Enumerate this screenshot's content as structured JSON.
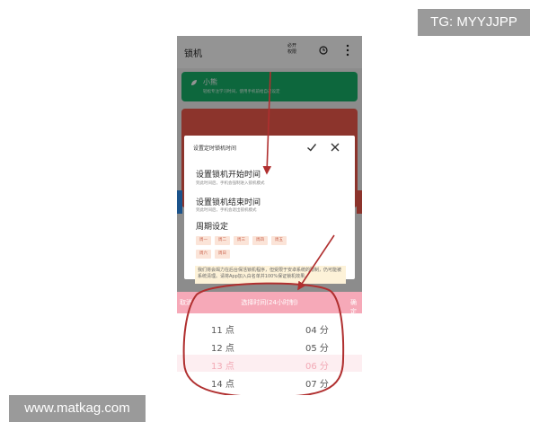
{
  "watermarks": {
    "telegram": "TG: MYYJJPP",
    "site": "www.matkag.com"
  },
  "app": {
    "title": "锁机",
    "permission_label": "必开权限",
    "icons": {
      "clock": "clock-icon",
      "more": "more-vertical-icon"
    }
  },
  "cards": [
    {
      "title": "小熊",
      "subtitle": "轻松专注学习时间，使用手机前给自己设定",
      "color": "#17b169",
      "icon": "leaf-icon"
    },
    {
      "color": "#f15b4c"
    }
  ],
  "dialog": {
    "title": "设置定时锁机时间",
    "icons": {
      "confirm": "check-icon",
      "close": "close-icon"
    },
    "options": [
      {
        "title": "设置锁机开始时间",
        "subtitle": "到此时间后，手机会强制进入锁机模式"
      },
      {
        "title": "设置锁机结束时间",
        "subtitle": "到此时间后，手机会退出锁机模式"
      }
    ],
    "cycle_title": "周期设定",
    "days": [
      "周一",
      "周二",
      "周三",
      "周四",
      "周五",
      "周六",
      "周日"
    ],
    "description": "我们将会竭力在后台保活锁机程序，但受限于安卓系统的限制，仍可能被系统清理。请将App加入白名单并100%保证锁机效果。"
  },
  "picker": {
    "title": "选择时间(24小时制)",
    "cancel_label": "取消",
    "ok_label": "确定",
    "rows": [
      {
        "hour": "11 点",
        "minute": "04 分",
        "selected": false
      },
      {
        "hour": "12 点",
        "minute": "05 分",
        "selected": false
      },
      {
        "hour": "13 点",
        "minute": "06 分",
        "selected": true
      },
      {
        "hour": "14 点",
        "minute": "07 分",
        "selected": false
      }
    ],
    "accent": "#f6a9b8"
  },
  "annotation_color": "#b02f2f"
}
